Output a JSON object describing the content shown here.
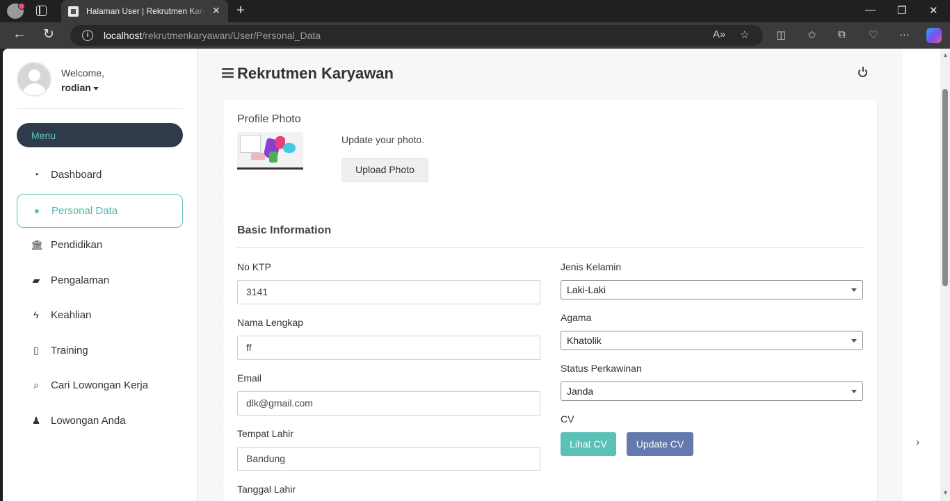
{
  "browser": {
    "tab_title": "Halaman User | Rekrutmen Karyawan",
    "close_tab_icon": "✕",
    "new_tab_icon": "+",
    "url_host": "localhost",
    "url_path": "/rekrutmenkaryawan/User/Personal_Data",
    "window_controls": {
      "minimize": "—",
      "restore": "❐",
      "close": "✕"
    }
  },
  "sidebar": {
    "welcome": "Welcome,",
    "username": "rodian",
    "menu_label": "Menu",
    "items": [
      {
        "label": "Dashboard",
        "icon": "dashboard-icon",
        "glyph": "◔",
        "active": false
      },
      {
        "label": "Personal Data",
        "icon": "user-icon",
        "glyph": "●",
        "active": true
      },
      {
        "label": "Pendidikan",
        "icon": "institution-icon",
        "glyph": "🏛",
        "active": false
      },
      {
        "label": "Pengalaman",
        "icon": "briefcase-icon",
        "glyph": "▰",
        "active": false
      },
      {
        "label": "Keahlian",
        "icon": "bolt-icon",
        "glyph": "ϟ",
        "active": false
      },
      {
        "label": "Training",
        "icon": "file-icon",
        "glyph": "▯",
        "active": false
      },
      {
        "label": "Cari Lowongan Kerja",
        "icon": "search-icon",
        "glyph": "⌕",
        "active": false
      },
      {
        "label": "Lowongan Anda",
        "icon": "person-icon",
        "glyph": "♟",
        "active": false
      }
    ]
  },
  "header": {
    "title": "Rekrutmen Karyawan"
  },
  "profile": {
    "title": "Profile Photo",
    "hint": "Update your photo.",
    "upload_button": "Upload Photo"
  },
  "basic_info": {
    "title": "Basic Information",
    "no_ktp": {
      "label": "No KTP",
      "value": "3141"
    },
    "nama_lengkap": {
      "label": "Nama Lengkap",
      "value": "ff"
    },
    "email": {
      "label": "Email",
      "value": "dlk@gmail.com"
    },
    "tempat_lahir": {
      "label": "Tempat Lahir",
      "value": "Bandung"
    },
    "tanggal_lahir": {
      "label": "Tanggal Lahir"
    },
    "jenis_kelamin": {
      "label": "Jenis Kelamin",
      "value": "Laki-Laki"
    },
    "agama": {
      "label": "Agama",
      "value": "Khatolik"
    },
    "status_perkawinan": {
      "label": "Status Perkawinan",
      "value": "Janda"
    },
    "cv": {
      "label": "CV",
      "lihat_button": "Lihat CV",
      "update_button": "Update CV"
    }
  },
  "colors": {
    "accent_teal": "#5bc0b7",
    "accent_blue": "#6479ad",
    "menu_dark": "#2f3a4a"
  }
}
